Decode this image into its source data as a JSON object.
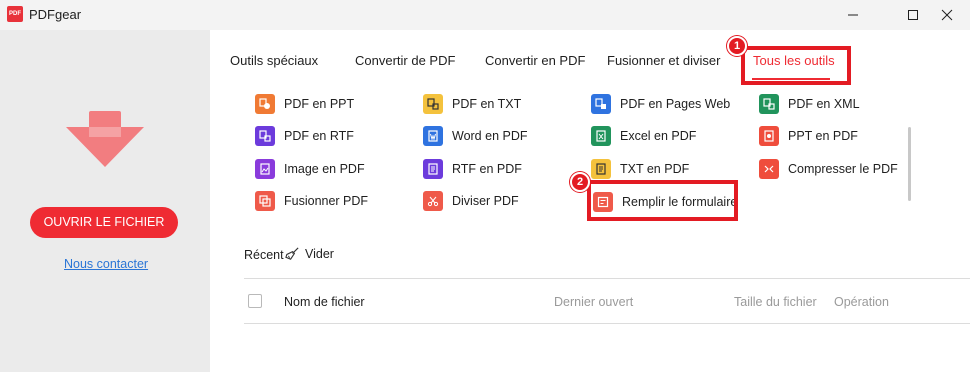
{
  "window": {
    "logo_text": "PDF",
    "title": "PDFgear",
    "controls": [
      "minimize-icon",
      "maximize-icon",
      "close-icon"
    ]
  },
  "sidebar": {
    "upload_icon": "download-arrow-icon",
    "open_button": "OUVRIR LE FICHIER",
    "contact_link": "Nous contacter"
  },
  "tabs": [
    {
      "label": "Outils spéciaux",
      "active": false
    },
    {
      "label": "Convertir de PDF",
      "active": false
    },
    {
      "label": "Convertir en PDF",
      "active": false
    },
    {
      "label": "Fusionner et diviser",
      "active": false
    },
    {
      "label": "Tous les outils",
      "active": true
    }
  ],
  "tools": [
    {
      "label": "PDF en PPT",
      "icon": "pdf-to-ppt-icon",
      "color": "#f07a34"
    },
    {
      "label": "PDF en TXT",
      "icon": "pdf-to-txt-icon",
      "color": "#f4c23d"
    },
    {
      "label": "PDF en Pages Web",
      "icon": "pdf-to-web-icon",
      "color": "#2f73e0"
    },
    {
      "label": "PDF en XML",
      "icon": "pdf-to-xml-icon",
      "color": "#21945c"
    },
    {
      "label": "PDF en RTF",
      "icon": "pdf-to-rtf-icon",
      "color": "#6c3bdc"
    },
    {
      "label": "Word en PDF",
      "icon": "word-to-pdf-icon",
      "color": "#2f73e0"
    },
    {
      "label": "Excel en PDF",
      "icon": "excel-to-pdf-icon",
      "color": "#21945c"
    },
    {
      "label": "PPT en PDF",
      "icon": "ppt-to-pdf-icon",
      "color": "#ef4d3c"
    },
    {
      "label": "Image en PDF",
      "icon": "image-to-pdf-icon",
      "color": "#8a3bdc"
    },
    {
      "label": "RTF en PDF",
      "icon": "rtf-to-pdf-icon",
      "color": "#6c3bdc"
    },
    {
      "label": "TXT en PDF",
      "icon": "txt-to-pdf-icon",
      "color": "#f4c23d"
    },
    {
      "label": "Compresser le PDF",
      "icon": "compress-pdf-icon",
      "color": "#ef4d3c"
    },
    {
      "label": "Fusionner PDF",
      "icon": "merge-pdf-icon",
      "color": "#ef5a4a"
    },
    {
      "label": "Diviser PDF",
      "icon": "split-pdf-icon",
      "color": "#ef5a4a"
    },
    {
      "label": "Remplir le formulaire",
      "icon": "fill-form-icon",
      "color": "#ef5a4a"
    }
  ],
  "annotations": {
    "marker_1": "1",
    "marker_2": "2"
  },
  "recent": {
    "label": "Récent",
    "clear_label": "Vider",
    "clear_icon": "broom-icon",
    "columns": [
      "Nom de fichier",
      "Dernier ouvert",
      "Taille du fichier",
      "Opération"
    ]
  },
  "colors": {
    "accent": "#ef2b33",
    "highlight": "#e31b23",
    "link": "#2a75d6",
    "sidebar_bg": "#ebebeb"
  }
}
